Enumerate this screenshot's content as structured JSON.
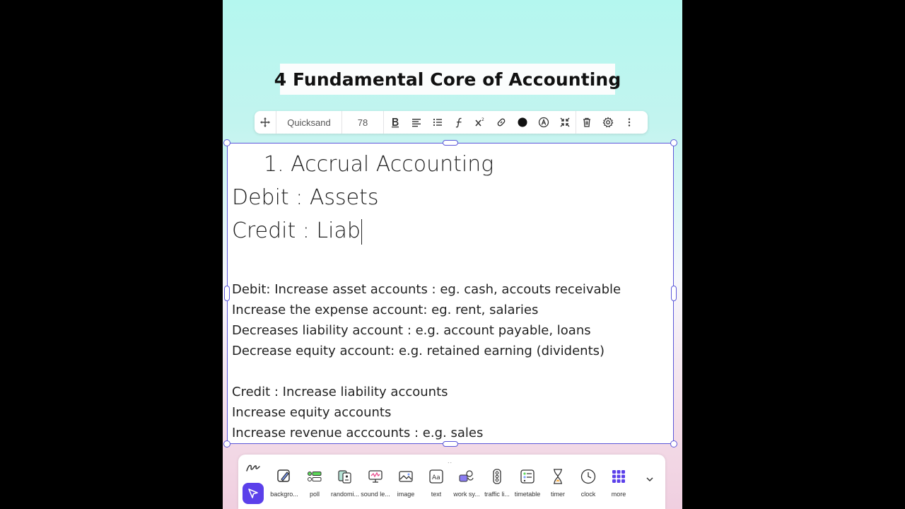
{
  "title": "4 Fundamental Core of Accounting",
  "toolbar": {
    "font": "Quicksand",
    "size": "78",
    "icons": [
      "move-icon",
      "bold-icon",
      "align-icon",
      "list-icon",
      "function-icon",
      "superscript-icon",
      "link-icon",
      "color-dot-icon",
      "highlight-icon",
      "collapse-icon",
      "delete-icon",
      "settings-icon",
      "more-vertical-icon"
    ],
    "color_dot": "#111111"
  },
  "content": {
    "heading": "1. Accrual Accounting",
    "line_debit": "Debit : Assets",
    "line_credit": "Credit : Liab",
    "debit_lines": [
      "Debit: Increase asset accounts : eg. cash, accouts receivable",
      "Increase the expense account: eg. rent, salaries",
      "Decreases liability account : e.g. account payable, loans",
      "Decrease equity account: e.g. retained earning (dividents)"
    ],
    "credit_lines": [
      "Credit : Increase liability accounts",
      "Increase equity accounts",
      "Increase revenue acccounts : e.g. sales"
    ]
  },
  "dock": {
    "grip": "..",
    "items": [
      {
        "label": "backgro...",
        "icon": "background-icon"
      },
      {
        "label": "poll",
        "icon": "poll-icon"
      },
      {
        "label": "randomi...",
        "icon": "randomizer-icon"
      },
      {
        "label": "sound le...",
        "icon": "sound-level-icon"
      },
      {
        "label": "image",
        "icon": "image-icon"
      },
      {
        "label": "text",
        "icon": "text-icon"
      },
      {
        "label": "work sy...",
        "icon": "work-symbols-icon"
      },
      {
        "label": "traffic li...",
        "icon": "traffic-light-icon"
      },
      {
        "label": "timetable",
        "icon": "timetable-icon"
      },
      {
        "label": "timer",
        "icon": "timer-icon"
      },
      {
        "label": "clock",
        "icon": "clock-icon"
      },
      {
        "label": "more",
        "icon": "more-grid-icon"
      }
    ]
  },
  "colors": {
    "accent": "#5b40ea",
    "selection": "#5b57d9"
  }
}
